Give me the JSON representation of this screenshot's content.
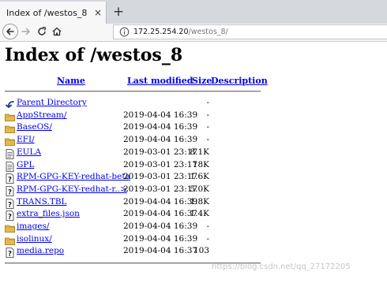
{
  "browser": {
    "tab_title": "Index of /westos_8",
    "tab_close": "×",
    "new_tab": "+",
    "url_host": "172.25.254.20",
    "url_path": "/westos_8/"
  },
  "page": {
    "heading": "Index of /westos_8",
    "columns": {
      "name": "Name",
      "last_modified": "Last modified",
      "size": "Size",
      "description": "Description"
    },
    "entries": [
      {
        "icon": "back-icon",
        "name": "Parent Directory",
        "modified": "",
        "size": "-"
      },
      {
        "icon": "folder-icon",
        "name": "AppStream/",
        "modified": "2019-04-04 16:39",
        "size": "-"
      },
      {
        "icon": "folder-icon",
        "name": "BaseOS/",
        "modified": "2019-04-04 16:39",
        "size": "-"
      },
      {
        "icon": "folder-icon",
        "name": "EFI/",
        "modified": "2019-04-04 16:39",
        "size": "-"
      },
      {
        "icon": "text-file-icon",
        "name": "EULA",
        "modified": "2019-03-01 23:17",
        "size": "8.1K"
      },
      {
        "icon": "text-file-icon",
        "name": "GPL",
        "modified": "2019-03-01 23:17",
        "size": "18K"
      },
      {
        "icon": "unknown-file-icon",
        "name": "RPM-GPG-KEY-redhat-beta",
        "modified": "2019-03-01 23:17",
        "size": "1.6K"
      },
      {
        "icon": "unknown-file-icon",
        "name": "RPM-GPG-KEY-redhat-r..>",
        "modified": "2019-03-01 23:17",
        "size": "5.0K"
      },
      {
        "icon": "unknown-file-icon",
        "name": "TRANS.TBL",
        "modified": "2019-04-04 16:39",
        "size": "1.8K"
      },
      {
        "icon": "unknown-file-icon",
        "name": "extra_files.json",
        "modified": "2019-04-04 16:37",
        "size": "1.4K"
      },
      {
        "icon": "folder-icon",
        "name": "images/",
        "modified": "2019-04-04 16:39",
        "size": "-"
      },
      {
        "icon": "folder-icon",
        "name": "isolinux/",
        "modified": "2019-04-04 16:39",
        "size": "-"
      },
      {
        "icon": "unknown-file-icon",
        "name": "media.repo",
        "modified": "2019-04-04 16:37",
        "size": "103"
      }
    ]
  },
  "watermark": "https://blog.csdn.net/qq_27172205",
  "colors": {
    "link": "#0000ee",
    "folder": "#e8b84a",
    "chrome": "#f7f7f8"
  }
}
